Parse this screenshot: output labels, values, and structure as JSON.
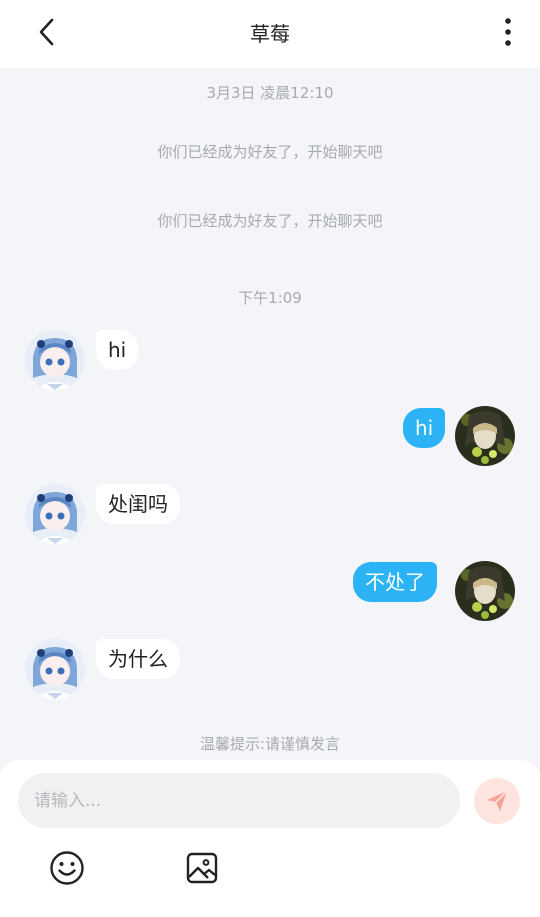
{
  "header": {
    "title": "草莓"
  },
  "messages": {
    "timestamp_1": "3月3日 凌晨12:10",
    "system_1": "你们已经成为好友了，开始聊天吧",
    "system_2": "你们已经成为好友了，开始聊天吧",
    "timestamp_2": "下午1:09",
    "items": [
      {
        "side": "left",
        "text": "hi"
      },
      {
        "side": "right",
        "text": "hi"
      },
      {
        "side": "left",
        "text": "处闺吗"
      },
      {
        "side": "right",
        "text": "不处了"
      },
      {
        "side": "left",
        "text": "为什么"
      }
    ],
    "tip": "温馨提示:请谨慎发言"
  },
  "composer": {
    "placeholder": "请输入...",
    "value": ""
  },
  "colors": {
    "accent": "#2bb3f5",
    "send_button": "#fde4df",
    "send_icon": "#f4a495"
  }
}
